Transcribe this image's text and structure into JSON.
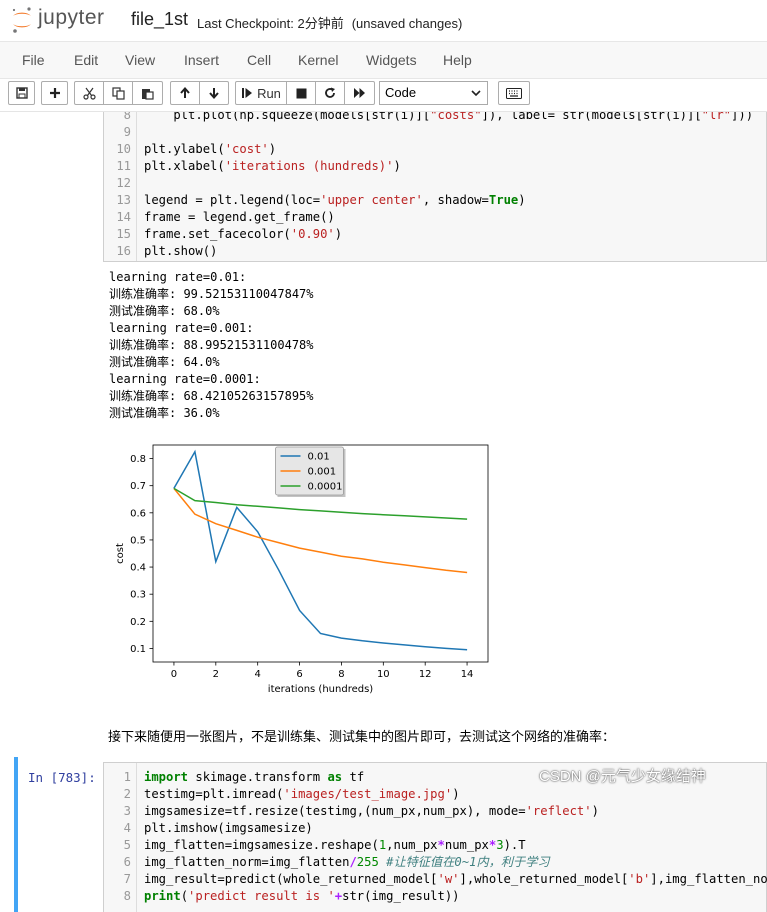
{
  "header": {
    "logo_text": "jupyter",
    "notebook_name": "file_1st",
    "checkpoint_label": "Last Checkpoint:",
    "checkpoint_time": "2分钟前",
    "save_status": "(unsaved changes)"
  },
  "menu": [
    "File",
    "Edit",
    "View",
    "Insert",
    "Cell",
    "Kernel",
    "Widgets",
    "Help"
  ],
  "toolbar": {
    "run_label": "Run",
    "cell_type": "Code",
    "icons": [
      "save-icon",
      "plus-icon",
      "cut-icon",
      "copy-icon",
      "paste-icon",
      "arrow-up-icon",
      "arrow-down-icon",
      "run-icon",
      "stop-icon",
      "restart-icon",
      "fast-forward-icon",
      "keyboard-icon"
    ]
  },
  "cell1": {
    "lines": [
      {
        "n": "8",
        "text": "    plt.plot(np.squeeze(models[str(i)][\"costs\"]), label= str(models[str(i)][\"lr\"]))"
      },
      {
        "n": "9",
        "text": ""
      },
      {
        "n": "10",
        "text": "plt.ylabel('cost')"
      },
      {
        "n": "11",
        "text": "plt.xlabel('iterations (hundreds)')"
      },
      {
        "n": "12",
        "text": ""
      },
      {
        "n": "13",
        "text": "legend = plt.legend(loc='upper center', shadow=True)"
      },
      {
        "n": "14",
        "text": "frame = legend.get_frame()"
      },
      {
        "n": "15",
        "text": "frame.set_facecolor('0.90')"
      },
      {
        "n": "16",
        "text": "plt.show()"
      }
    ]
  },
  "output": [
    "learning rate=0.01:",
    "训练准确率: 99.52153110047847%",
    "测试准确率: 68.0%",
    "learning rate=0.001:",
    "训练准确率: 88.99521531100478%",
    "测试准确率: 64.0%",
    "learning rate=0.0001:",
    "训练准确率: 68.42105263157895%",
    "测试准确率: 36.0%"
  ],
  "chart_data": {
    "type": "line",
    "xlabel": "iterations (hundreds)",
    "ylabel": "cost",
    "xlim": [
      -1,
      15
    ],
    "ylim": [
      0.05,
      0.85
    ],
    "xticks": [
      0,
      2,
      4,
      6,
      8,
      10,
      12,
      14
    ],
    "yticks": [
      0.1,
      0.2,
      0.3,
      0.4,
      0.5,
      0.6,
      0.7,
      0.8
    ],
    "legend_position": "upper center",
    "series": [
      {
        "name": "0.01",
        "color": "#1f77b4",
        "x": [
          0,
          1,
          2,
          3,
          4,
          5,
          6,
          7,
          8,
          9,
          10,
          11,
          12,
          13,
          14
        ],
        "y": [
          0.69,
          0.825,
          0.42,
          0.62,
          0.53,
          0.39,
          0.24,
          0.155,
          0.138,
          0.128,
          0.12,
          0.113,
          0.106,
          0.1,
          0.095
        ]
      },
      {
        "name": "0.001",
        "color": "#ff7f0e",
        "x": [
          0,
          1,
          2,
          3,
          4,
          5,
          6,
          7,
          8,
          9,
          10,
          11,
          12,
          13,
          14
        ],
        "y": [
          0.69,
          0.595,
          0.56,
          0.535,
          0.51,
          0.49,
          0.47,
          0.455,
          0.44,
          0.43,
          0.418,
          0.408,
          0.398,
          0.388,
          0.38
        ]
      },
      {
        "name": "0.0001",
        "color": "#2ca02c",
        "x": [
          0,
          1,
          2,
          3,
          4,
          5,
          6,
          7,
          8,
          9,
          10,
          11,
          12,
          13,
          14
        ],
        "y": [
          0.69,
          0.645,
          0.638,
          0.63,
          0.624,
          0.618,
          0.612,
          0.607,
          0.602,
          0.597,
          0.593,
          0.589,
          0.585,
          0.581,
          0.577
        ]
      }
    ]
  },
  "markdown": "接下来随便用一张图片，不是训练集、测试集中的图片即可，去测试这个网络的准确率：",
  "cell2": {
    "prompt": "In  [783]:",
    "lines": [
      {
        "n": "1",
        "text": "import skimage.transform as tf"
      },
      {
        "n": "2",
        "text": "testimg=plt.imread('images/test_image.jpg')"
      },
      {
        "n": "3",
        "text": "imgsamesize=tf.resize(testimg,(num_px,num_px), mode='reflect')"
      },
      {
        "n": "4",
        "text": "plt.imshow(imgsamesize)"
      },
      {
        "n": "5",
        "text": "img_flatten=imgsamesize.reshape(1,num_px*num_px*3).T"
      },
      {
        "n": "6",
        "text": "img_flatten_norm=img_flatten/255 #让特征值在0~1内，利于学习"
      },
      {
        "n": "7",
        "text": "img_result=predict(whole_returned_model['w'],whole_returned_model['b'],img_flatten_norm)"
      },
      {
        "n": "8",
        "text": "print('predict result is '+str(img_result))"
      }
    ]
  },
  "watermark": "CSDN @元气少女缘结神"
}
